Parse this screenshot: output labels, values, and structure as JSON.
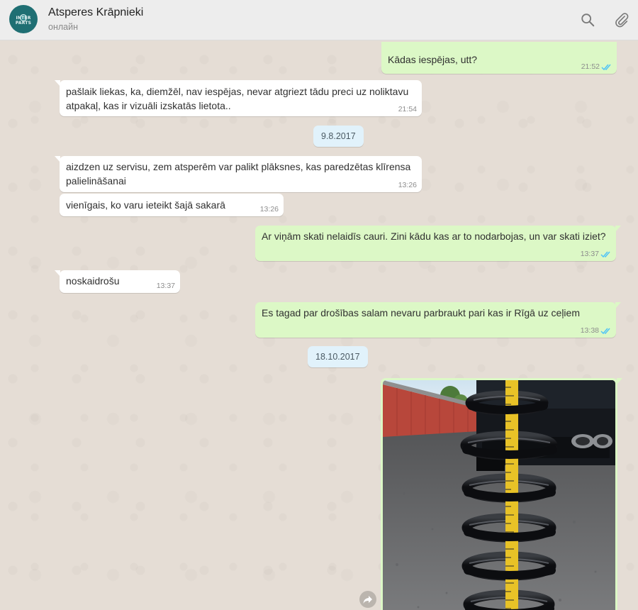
{
  "header": {
    "title": "Atsperes Krāpnieki",
    "status": "онлайн",
    "avatar_text": "INTER PARTS",
    "icons": [
      "search-icon",
      "attach-icon"
    ]
  },
  "messages": [
    {
      "direction": "out",
      "text": "Kādas iespējas, utt?",
      "time": "21:52",
      "status": "read"
    },
    {
      "direction": "in",
      "text": "pašlaik liekas, ka, diemžēl, nav iespējas, nevar atgriezt tādu preci uz noliktavu atpakaļ, kas ir vizuāli izskatās lietota..",
      "time": "21:54"
    },
    {
      "type": "date",
      "text": "9.8.2017"
    },
    {
      "direction": "in",
      "text": "aizdzen uz servisu, zem atsperēm var palikt plāksnes, kas paredzētas klīrensa palielināšanai",
      "time": "13:26"
    },
    {
      "direction": "in",
      "text": "vienīgais, ko varu ieteikt šajā sakarā",
      "time": "13:26"
    },
    {
      "direction": "out",
      "text": "Ar viņām skati nelaidīs cauri. Zini kādu kas ar to nodarbojas, un var skati iziet?",
      "time": "13:37",
      "status": "read"
    },
    {
      "direction": "in",
      "text": "noskaidrošu",
      "time": "13:37"
    },
    {
      "direction": "out",
      "text": "Es tagad par drošības salam nevaru parbraukt pari kas ir Rīgā uz ceļiem",
      "time": "13:38",
      "status": "read"
    },
    {
      "type": "date",
      "text": "18.10.2017"
    },
    {
      "direction": "out",
      "type": "image",
      "image_description": "photo-of-coil-spring-with-tape-measure"
    }
  ],
  "colors": {
    "chat_bg": "#e5ddd5",
    "outgoing_bubble": "#dcf8c6",
    "incoming_bubble": "#ffffff",
    "date_chip": "#e1f2fb",
    "read_ticks": "#4fc3f7",
    "header_bg": "#ededed"
  }
}
